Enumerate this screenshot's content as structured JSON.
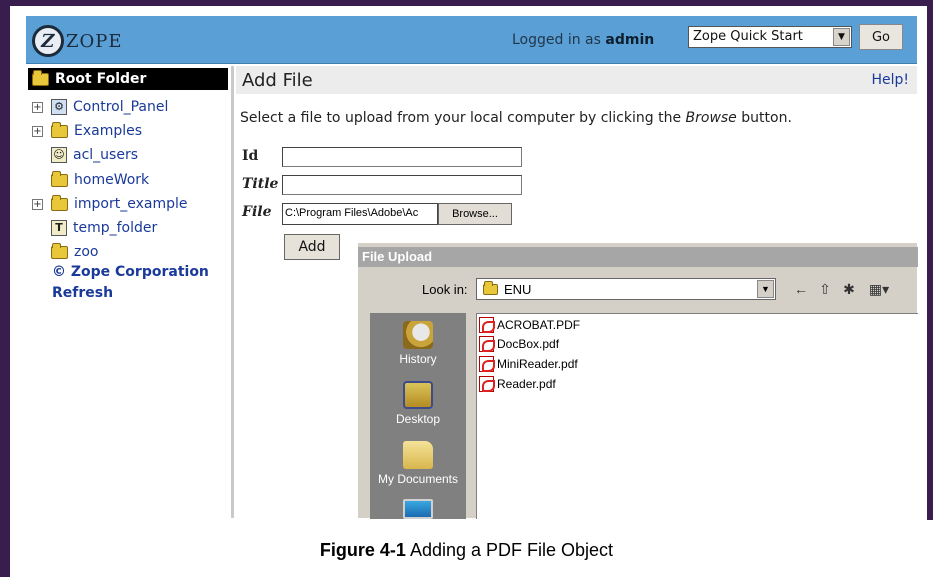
{
  "header": {
    "logo_text": "ZOPE",
    "logged_in_prefix": "Logged in as",
    "logged_in_user": "admin",
    "quickstart_value": "Zope Quick Start",
    "go_label": "Go"
  },
  "tree": {
    "root_label": "Root Folder",
    "items": [
      {
        "label": "Control_Panel",
        "expandable": true,
        "icon": "control-panel-icon"
      },
      {
        "label": "Examples",
        "expandable": true,
        "icon": "folder-icon"
      },
      {
        "label": "acl_users",
        "expandable": false,
        "icon": "user-folder-icon"
      },
      {
        "label": "homeWork",
        "expandable": false,
        "icon": "folder-icon"
      },
      {
        "label": "import_example",
        "expandable": true,
        "icon": "folder-icon"
      },
      {
        "label": "temp_folder",
        "expandable": false,
        "icon": "temp-folder-icon"
      },
      {
        "label": "zoo",
        "expandable": false,
        "icon": "folder-icon"
      }
    ],
    "copyright": "© Zope Corporation",
    "refresh": "Refresh"
  },
  "main": {
    "title": "Add File",
    "help": "Help!",
    "instructions_before": "Select a file to upload from your local computer by clicking the ",
    "instructions_em": "Browse",
    "instructions_after": " button.",
    "labels": {
      "id": "Id",
      "title": "Title",
      "file": "File"
    },
    "fields": {
      "id": "",
      "title": "",
      "file": "C:\\Program Files\\Adobe\\Ac"
    },
    "browse_label": "Browse...",
    "add_label": "Add"
  },
  "dialog": {
    "title": "File Upload",
    "lookin_label": "Look in:",
    "lookin_value": "ENU",
    "places": [
      "History",
      "Desktop",
      "My Documents"
    ],
    "files": [
      "ACROBAT.PDF",
      "DocBox.pdf",
      "MiniReader.pdf",
      "Reader.pdf"
    ]
  },
  "caption": {
    "number": "Figure 4-1",
    "text": "Adding a PDF File Object"
  }
}
